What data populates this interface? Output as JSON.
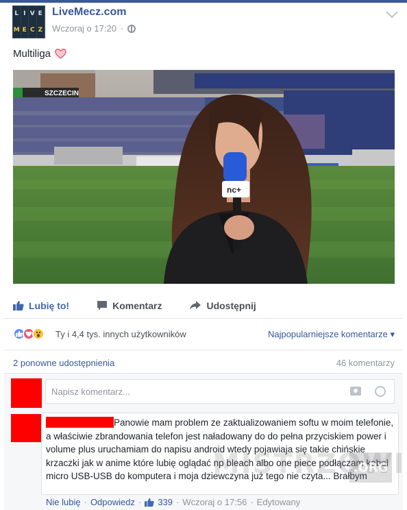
{
  "post": {
    "page_name": "LiveMecz.com",
    "timestamp": "Wczoraj o 17:20",
    "separator": "·",
    "text": "Multiliga",
    "avatar_letters_top": [
      "L",
      "I",
      "V",
      "E"
    ],
    "avatar_letters_bottom": [
      "M",
      "E",
      "C",
      "Z"
    ]
  },
  "photo": {
    "banner": "SZCZECIN",
    "mic_logo": "nc+"
  },
  "actions": {
    "like": "Lubię to!",
    "comment": "Komentarz",
    "share": "Udostępnij"
  },
  "reactions": {
    "summary": "Ty i 4,4 tys. innych użytkowników",
    "sort_label": "Najpopularniejsze komentarze",
    "sort_caret": "▾"
  },
  "stats": {
    "shares": "2 ponowne udostępnienia",
    "comments": "46 komentarzy"
  },
  "comment_input": {
    "placeholder": "Napisz komentarz..."
  },
  "comment": {
    "text": "Panowie mam problem ze zaktualizowaniem softu w moim telefonie, a właściwie zbrandowania telefon jest naładowany do do pełna przyciskiem power i volume plus uruchamiam do napisu android wtedy pojawiaja się takie chińskie krzaczki jak w anime które lubię oglądać np bleach albo one piece podłączam kabel micro USB-USB do komputera i moja dziewczyna już tego nie czyta... Brałbym",
    "unlike": "Nie lubię",
    "reply": "Odpowiedz",
    "likes": "339",
    "time": "Wczoraj o 17:56",
    "edited": "Edytowany",
    "dot": "·"
  },
  "watermark": {
    "text": "MISTRZOWIE",
    "suffix": ".ORG"
  },
  "colors": {
    "facebook_blue": "#3b5998",
    "link": "#365899",
    "like_blue": "#4267b2",
    "redaction": "#ff0000"
  }
}
